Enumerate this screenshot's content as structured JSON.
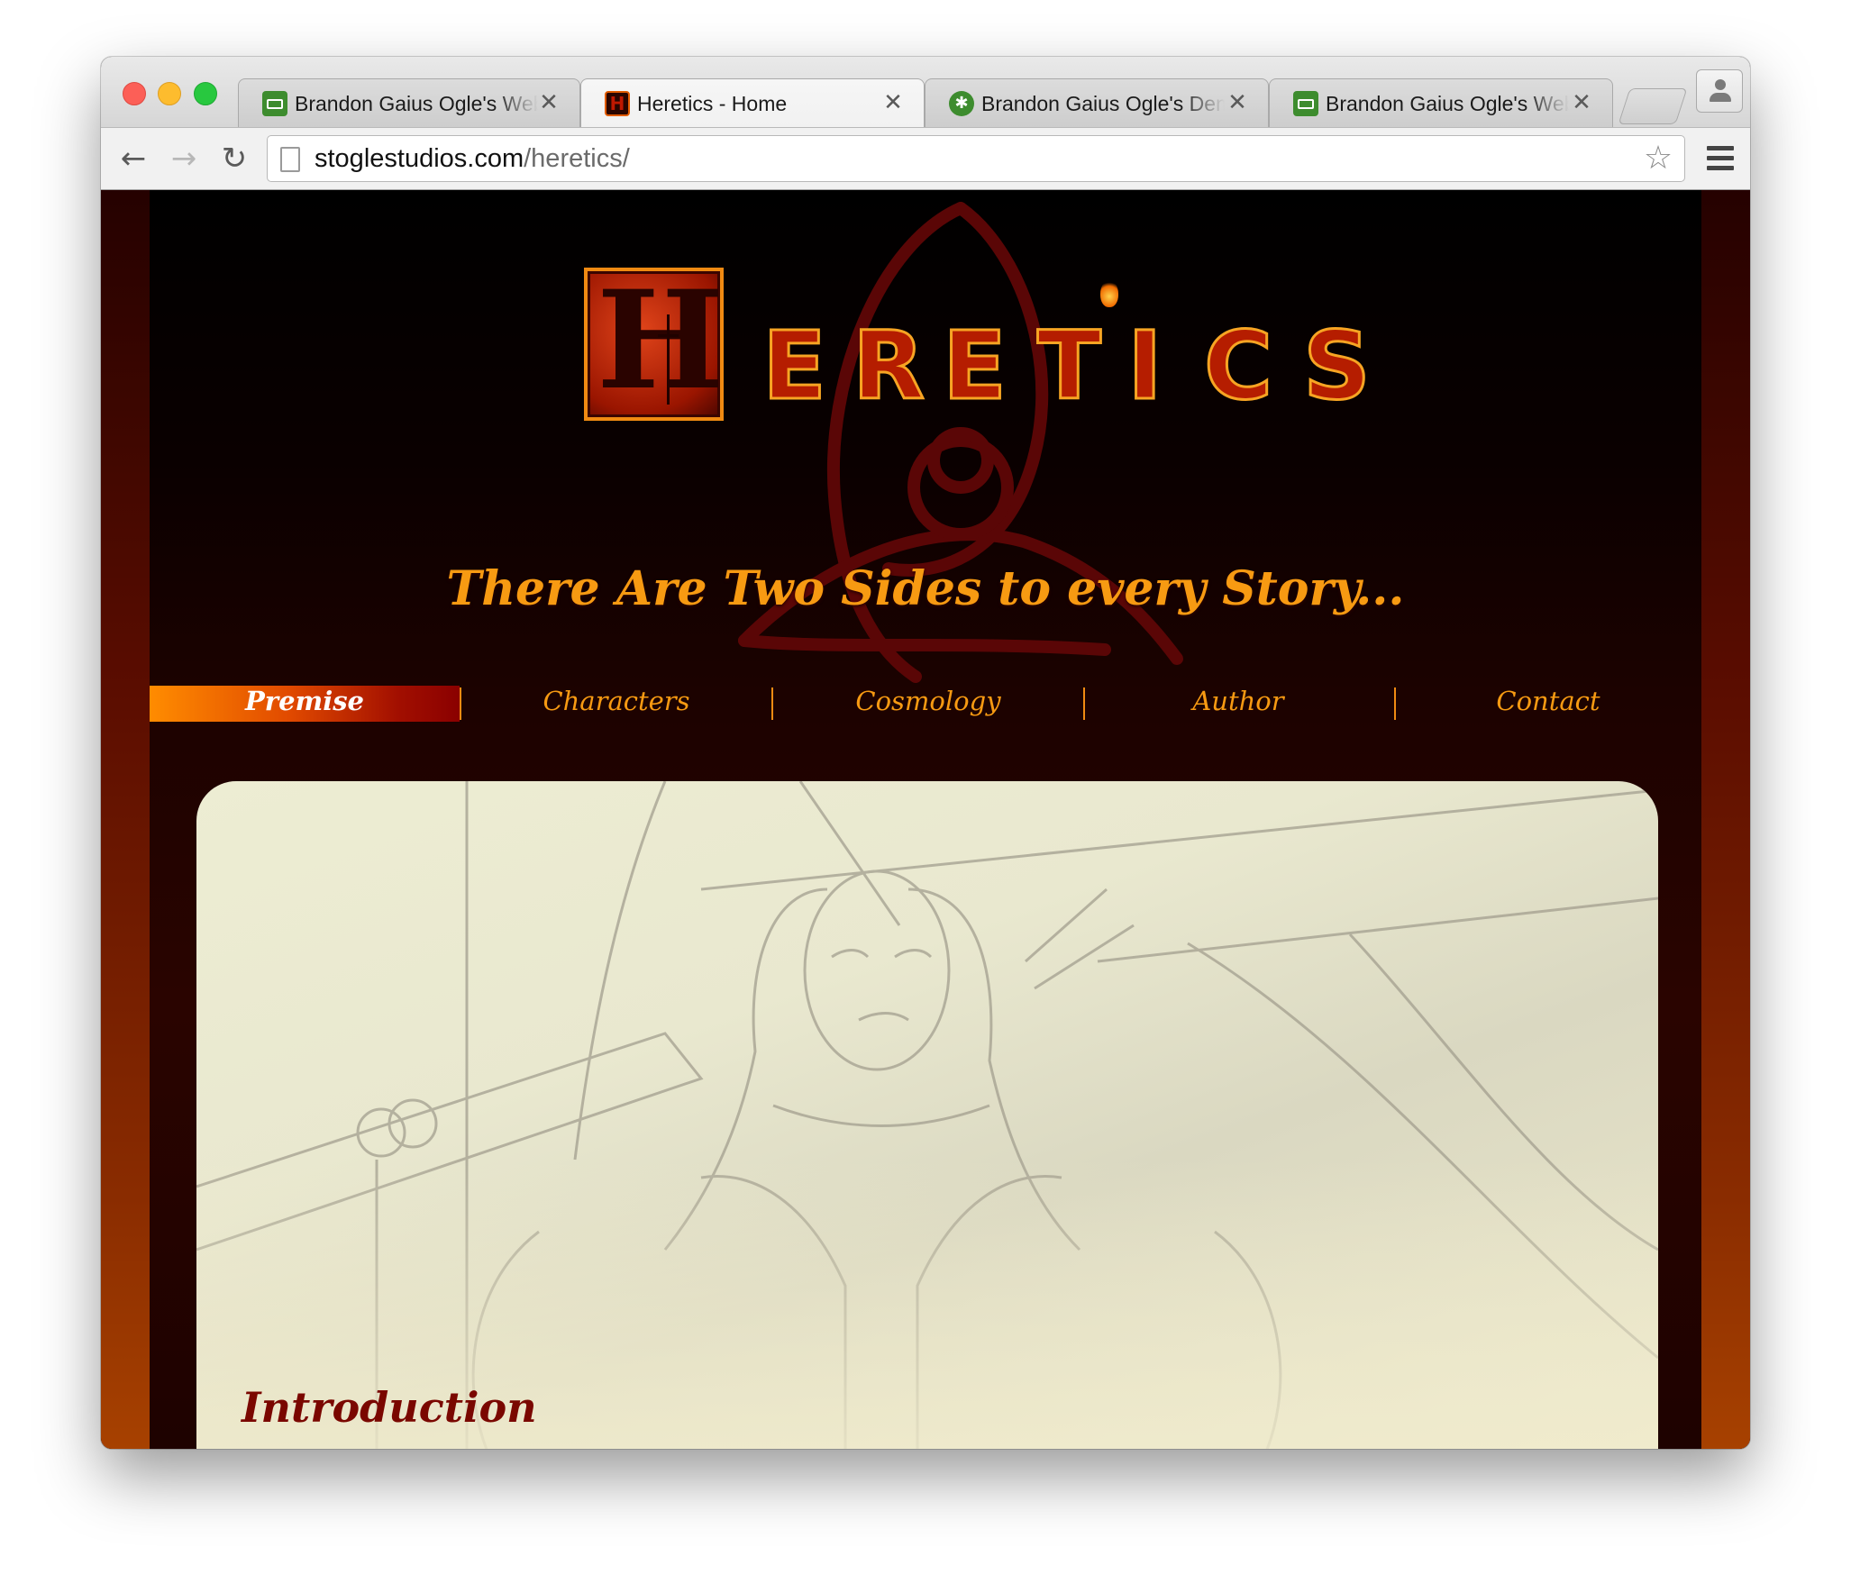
{
  "browser": {
    "tabs": [
      {
        "title": "Brandon Gaius Ogle's Web",
        "icon": "briefcase-icon",
        "active": false
      },
      {
        "title": "Heretics - Home",
        "icon": "heretics-h-icon",
        "active": true
      },
      {
        "title": "Brandon Gaius Ogle's Dem",
        "icon": "gear-icon",
        "active": false
      },
      {
        "title": "Brandon Gaius Ogle's Web",
        "icon": "briefcase-icon",
        "active": false
      }
    ],
    "close_glyph": "✕",
    "back_glyph": "←",
    "forward_glyph": "→",
    "reload_glyph": "↻",
    "star_glyph": "☆",
    "url_host": "stoglestudios.com",
    "url_path": "/heretics/"
  },
  "site": {
    "logo_initial": "H",
    "logo_rest": [
      "E",
      "R",
      "E",
      "T",
      "I",
      "C",
      "S"
    ],
    "tagline": "There Are Two Sides to every Story...",
    "nav": [
      {
        "label": "Premise",
        "active": true
      },
      {
        "label": "Characters",
        "active": false
      },
      {
        "label": "Cosmology",
        "active": false
      },
      {
        "label": "Author",
        "active": false
      },
      {
        "label": "Contact",
        "active": false
      }
    ],
    "intro_heading": "Introduction",
    "colors": {
      "accent_orange": "#f79a12",
      "heading_red": "#7a0700",
      "background": "#000000"
    }
  }
}
